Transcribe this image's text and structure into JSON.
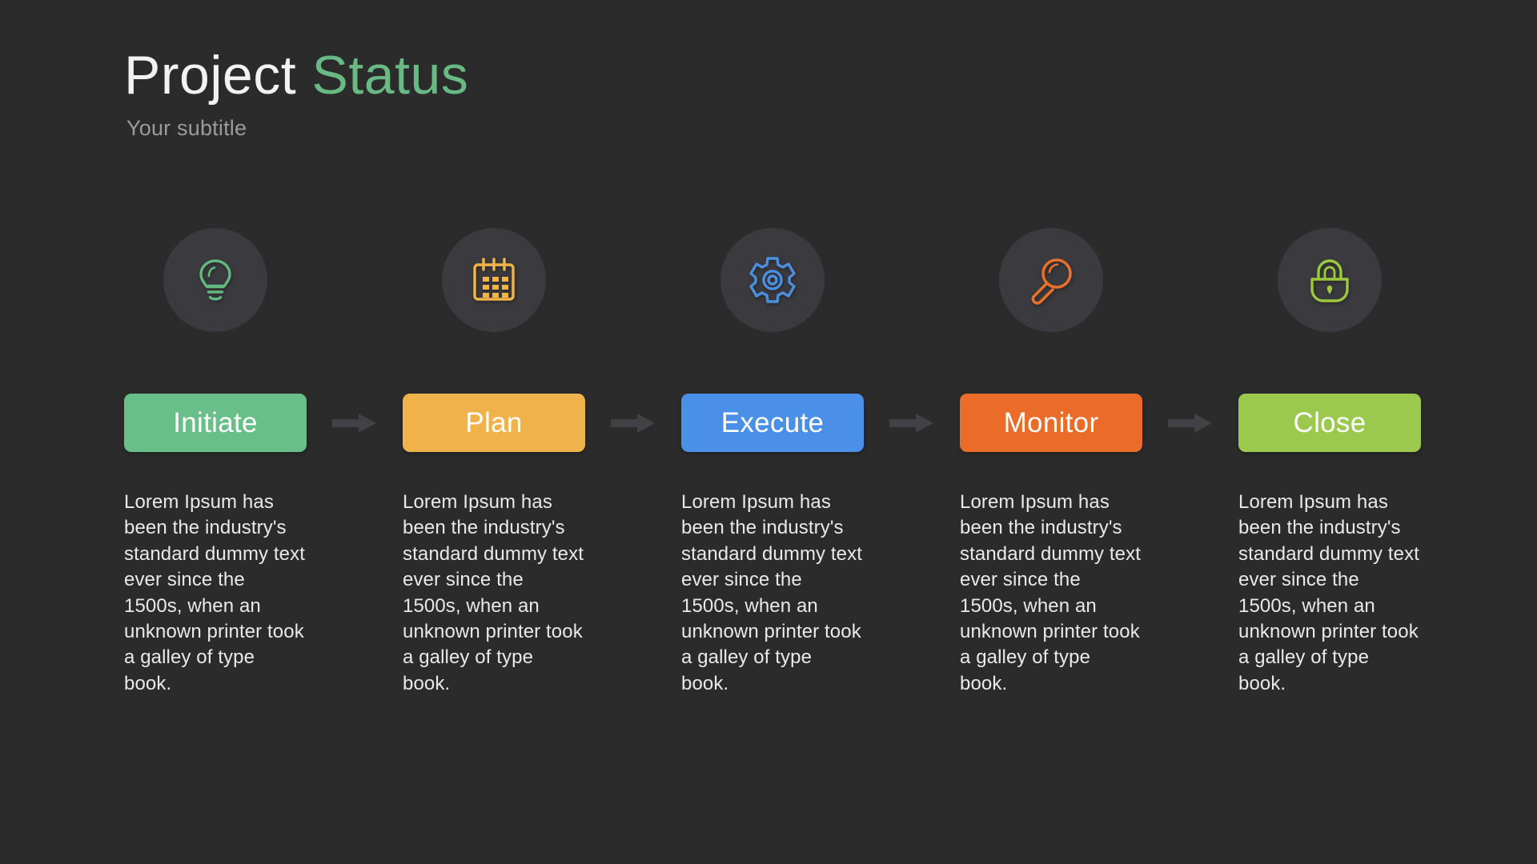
{
  "header": {
    "title_main": "Project",
    "title_accent": "Status",
    "subtitle": "Your subtitle"
  },
  "theme": {
    "background": "#2b2b2b",
    "icon_circle": "#3b3b3f",
    "arrow": "#414146",
    "title_main_color": "#f2f2f2",
    "title_accent_color": "#68b983",
    "subtitle_color": "#9a9a9f",
    "body_text_color": "#e9e9e9"
  },
  "steps": [
    {
      "icon": "lightbulb-icon",
      "icon_color": "#62b97f",
      "label": "Initiate",
      "pill_color": "#68bf88",
      "description": "Lorem Ipsum has been the industry's standard dummy text ever since the 1500s, when an unknown printer took a galley of type book."
    },
    {
      "icon": "calendar-icon",
      "icon_color": "#f2b545",
      "label": "Plan",
      "pill_color": "#f0b24a",
      "description": "Lorem Ipsum has been the industry's standard dummy text ever since the 1500s, when an unknown printer took a galley of type book."
    },
    {
      "icon": "gear-icon",
      "icon_color": "#4a8fe0",
      "label": "Execute",
      "pill_color": "#4a90e8",
      "description": "Lorem Ipsum has been the industry's standard dummy text ever since the 1500s, when an unknown printer took a galley of type book."
    },
    {
      "icon": "magnifier-icon",
      "icon_color": "#e8702a",
      "label": "Monitor",
      "pill_color": "#ea6c28",
      "description": "Lorem Ipsum has been the industry's standard dummy text ever since the 1500s, when an unknown printer took a galley of type book."
    },
    {
      "icon": "lock-icon",
      "icon_color": "#9ec93e",
      "label": "Close",
      "pill_color": "#9ac94e",
      "description": "Lorem Ipsum has been the industry's standard dummy text ever since the 1500s, when an unknown printer took a galley of type book."
    }
  ],
  "arrows": [
    {
      "name": "arrow-initiate-to-plan"
    },
    {
      "name": "arrow-plan-to-execute"
    },
    {
      "name": "arrow-execute-to-monitor"
    },
    {
      "name": "arrow-monitor-to-close"
    }
  ]
}
